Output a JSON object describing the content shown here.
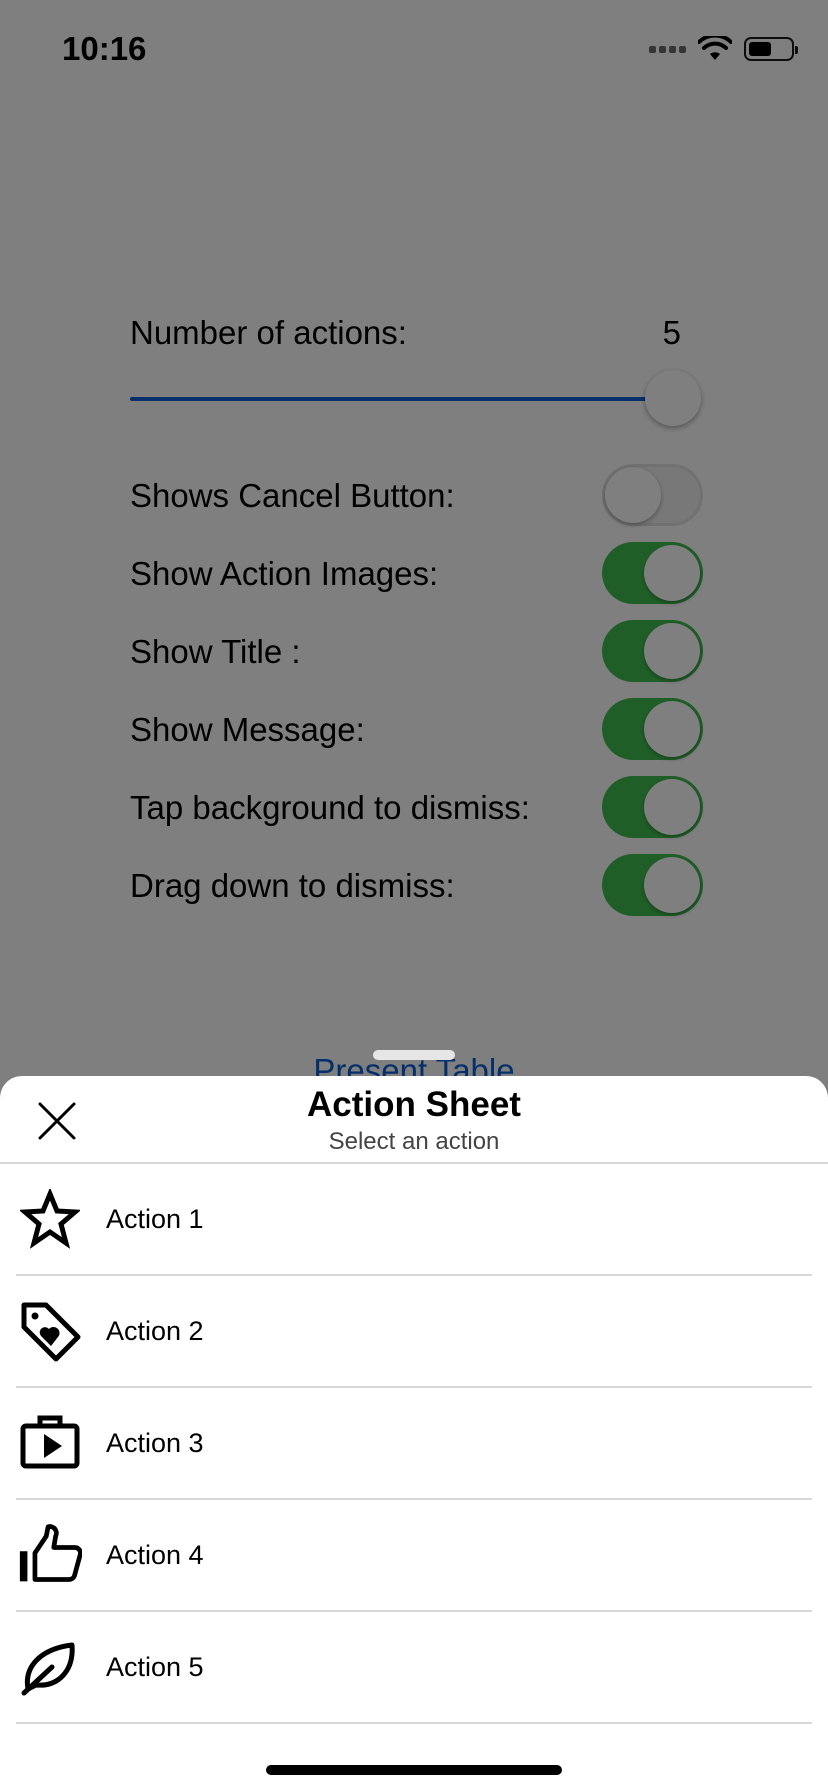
{
  "status_bar": {
    "time": "10:16"
  },
  "settings": {
    "number_of_actions_label": "Number of actions:",
    "number_of_actions_value": "5",
    "slider_level": 1.0,
    "switches": [
      {
        "label": "Shows Cancel Button:",
        "on": false
      },
      {
        "label": "Show Action Images:",
        "on": true
      },
      {
        "label": "Show Title :",
        "on": true
      },
      {
        "label": "Show Message:",
        "on": true
      },
      {
        "label": "Tap background to dismiss:",
        "on": true
      },
      {
        "label": "Drag down to dismiss:",
        "on": true
      }
    ],
    "present_table_label": "Present Table"
  },
  "action_sheet": {
    "title": "Action Sheet",
    "subtitle": "Select an action",
    "actions": [
      {
        "label": "Action 1",
        "icon": "star-icon"
      },
      {
        "label": "Action 2",
        "icon": "tag-heart-icon"
      },
      {
        "label": "Action 3",
        "icon": "briefcase-play-icon"
      },
      {
        "label": "Action 4",
        "icon": "thumbs-up-icon"
      },
      {
        "label": "Action 5",
        "icon": "leaf-icon"
      }
    ]
  },
  "colors": {
    "accent": "#0a5fd6",
    "switch_on": "#3fbf4e"
  }
}
